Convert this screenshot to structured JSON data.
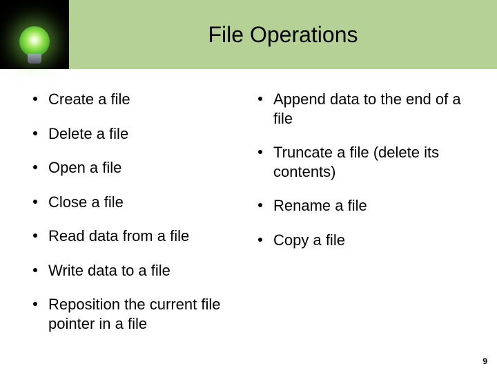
{
  "title": "File Operations",
  "left_items": [
    "Create a file",
    "Delete a file",
    "Open a file",
    "Close a file",
    "Read data from a file",
    "Write data to a file",
    "Reposition the current file pointer in a file"
  ],
  "right_items": [
    "Append data to the end of a file",
    "Truncate a file (delete its contents)",
    "Rename a file",
    "Copy a file"
  ],
  "page_number": "9"
}
